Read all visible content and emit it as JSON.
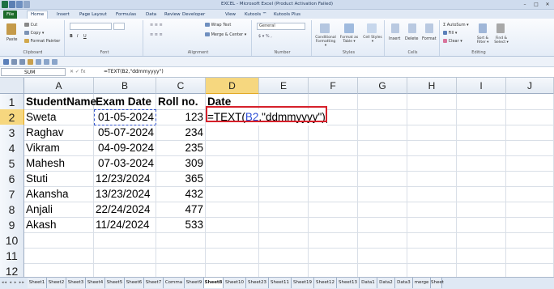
{
  "window": {
    "title": "EXCEL - Microsoft Excel (Product Activation Failed)"
  },
  "menu": {
    "tabs": [
      "File",
      "Home",
      "Insert",
      "Page Layout",
      "Formulas",
      "Data",
      "Review",
      "Developer",
      "View",
      "Kutools ™",
      "Kutools Plus"
    ]
  },
  "ribbon": {
    "clipboard": {
      "name": "Clipboard",
      "paste": "Paste",
      "cut": "Cut",
      "copy": "Copy ▾",
      "format_painter": "Format Painter"
    },
    "font": {
      "name": "Font"
    },
    "alignment": {
      "name": "Alignment",
      "wrap_text": "Wrap Text",
      "merge_center": "Merge & Center ▾"
    },
    "number": {
      "name": "Number",
      "format": "General"
    },
    "styles": {
      "name": "Styles",
      "conditional": "Conditional Formatting ▾",
      "format_table": "Format as Table ▾",
      "cell_styles": "Cell Styles ▾"
    },
    "cells": {
      "name": "Cells",
      "insert": "Insert",
      "delete": "Delete",
      "format": "Format"
    },
    "editing": {
      "name": "Editing",
      "autosum": "AutoSum ▾",
      "fill": "Fill ▾",
      "clear": "Clear ▾",
      "sort_filter": "Sort & Filter ▾",
      "find_select": "Find & Select ▾"
    }
  },
  "formula_bar": {
    "name_box": "SUM",
    "fx_icons": "✕ ✓ fx",
    "formula": "=TEXT(B2,\"ddmmyyyy\")"
  },
  "grid": {
    "columns": [
      "A",
      "B",
      "C",
      "D",
      "E",
      "F",
      "G",
      "H",
      "I",
      "J"
    ],
    "rows": [
      "1",
      "2",
      "3",
      "4",
      "5",
      "6",
      "7",
      "8",
      "9",
      "10",
      "11",
      "12"
    ],
    "headers": {
      "a": "StudentName",
      "b": "Exam Date",
      "c": "Roll no.",
      "d": "Date"
    },
    "data": [
      {
        "name": "Sweta",
        "date": "01-05-2024",
        "roll": "123"
      },
      {
        "name": "Raghav",
        "date": "05-07-2024",
        "roll": "234"
      },
      {
        "name": "Vikram",
        "date": "04-09-2024",
        "roll": "235"
      },
      {
        "name": "Mahesh",
        "date": "07-03-2024",
        "roll": "309"
      },
      {
        "name": "Stuti",
        "date": "12/23/2024",
        "roll": "365"
      },
      {
        "name": "Akansha",
        "date": "13/23/2024",
        "roll": "432"
      },
      {
        "name": "Anjali",
        "date": "22/24/2024",
        "roll": "477"
      },
      {
        "name": "Akash",
        "date": "11/24/2024",
        "roll": "533"
      }
    ],
    "edit": {
      "prefix": "=TEXT(",
      "ref": "B2",
      "suffix": ",\"ddmmyyyy\")"
    }
  },
  "sheet_tabs": {
    "nav": "◂◂ ◂ ▸ ▸▸",
    "tabs": [
      "Sheet1",
      "Sheet2",
      "Sheet3",
      "Sheet4",
      "Sheet5",
      "Sheet6",
      "Sheet7",
      "Comma",
      "Sheet9",
      "Sheet8",
      "Sheet10",
      "Sheet23",
      "Sheet11",
      "Sheet19",
      "Sheet12",
      "Sheet13",
      "Data1",
      "Data2",
      "Data3",
      "merge",
      "Sheet"
    ],
    "active": "Sheet8"
  },
  "colors": {
    "file_tab": "#1d6b2a",
    "selection": "#f6d77f",
    "edit_border": "#d6202a",
    "ref": "#2f4fd6"
  }
}
